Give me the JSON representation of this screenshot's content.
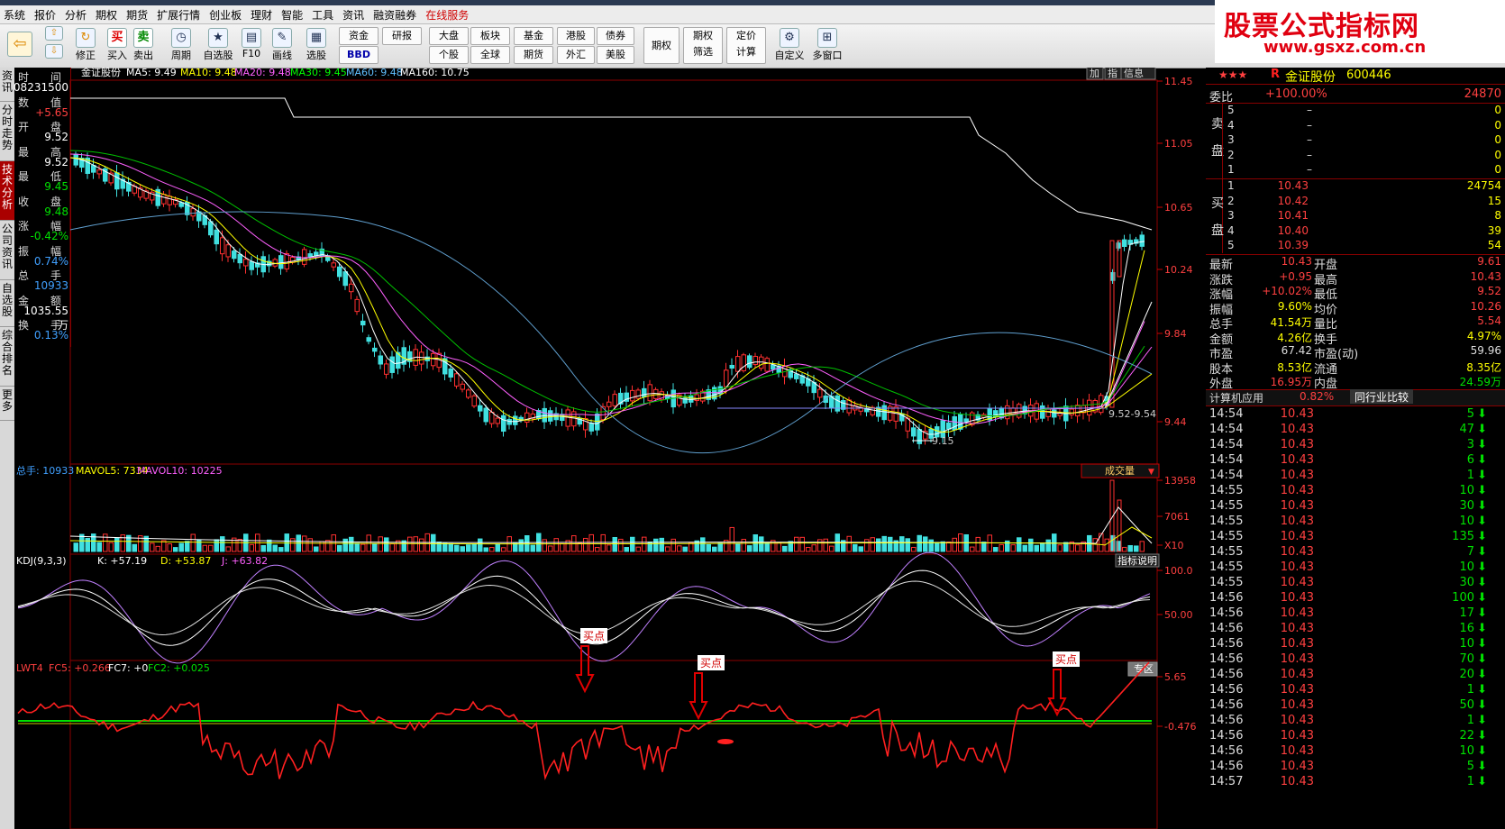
{
  "menu": {
    "items": [
      "系统",
      "报价",
      "分析",
      "期权",
      "期货",
      "扩展行情",
      "创业板",
      "理财",
      "智能",
      "工具",
      "资讯",
      "融资融券",
      "在线服务"
    ],
    "highlight": "在线服务"
  },
  "toolbar": {
    "buy": "买入",
    "sell": "卖出",
    "period": "周期",
    "fav": "自选股",
    "f10": "F10",
    "draw": "画线",
    "pick": "选股",
    "fix": "修正",
    "zj": "资金",
    "yb": "研报",
    "bbd": "BBD",
    "dp": "大盘",
    "bk": "板块",
    "jj": "基金",
    "gg": "港股",
    "zq": "债券",
    "gg2": "个股",
    "qq": "全球",
    "qh": "期货",
    "wh": "外汇",
    "mg": "美股",
    "qqn": "期权",
    "qqsx": "期权\n筛选",
    "djjs": "定价\n计算",
    "zdy": "自定义",
    "dck": "多窗口",
    "buy_glyph": "买",
    "sell_glyph": "卖"
  },
  "watermark": {
    "line1": "股票公式指标网",
    "line2": "www.gsxz.com.cn"
  },
  "vtabs": [
    {
      "label": "资讯",
      "on": false
    },
    {
      "label": "分时走势",
      "on": false
    },
    {
      "label": "技术分析",
      "on": true
    },
    {
      "label": "公司资讯",
      "on": false
    },
    {
      "label": "自选股",
      "on": false
    },
    {
      "label": "综合排名",
      "on": false
    },
    {
      "label": "更多",
      "on": false
    }
  ],
  "info": {
    "rows": [
      {
        "k": "时　　间",
        "v": "08231500",
        "c": "#ffffff"
      },
      {
        "k": "数　　值",
        "v": "+5.65",
        "c": "#ff4040"
      },
      {
        "k": "开　　盘",
        "v": "9.52",
        "c": "#ffffff"
      },
      {
        "k": "最　　高",
        "v": "9.52",
        "c": "#ffffff"
      },
      {
        "k": "最　　低",
        "v": "9.45",
        "c": "#00e000"
      },
      {
        "k": "收　　盘",
        "v": "9.48",
        "c": "#00e000"
      },
      {
        "k": "涨　　幅",
        "v": "-0.42%",
        "c": "#00e000"
      },
      {
        "k": "振　　幅",
        "v": "0.74%",
        "c": "#40a0ff"
      },
      {
        "k": "总　　手",
        "v": "10933",
        "c": "#40a0ff"
      },
      {
        "k": "金　　额",
        "v": "1035.55万",
        "c": "#ffffff"
      },
      {
        "k": "换　　手",
        "v": "0.13%",
        "c": "#40a0ff"
      }
    ]
  },
  "main": {
    "stock_name": "金证股份",
    "ma": [
      {
        "label": "MA5: 9.49",
        "color": "#ffffff"
      },
      {
        "label": "MA10: 9.48",
        "color": "#ffff00"
      },
      {
        "label": "MA20: 9.48",
        "color": "#ff60ff"
      },
      {
        "label": "MA30: 9.45",
        "color": "#00ff00"
      },
      {
        "label": "MA60: 9.48",
        "color": "#60c0ff"
      },
      {
        "label": "MA160: 10.75",
        "color": "#ffffff"
      }
    ],
    "buttons": [
      "加",
      "指",
      "信息"
    ],
    "y_ticks": [
      "11.45",
      "11.05",
      "10.65",
      "10.24",
      "9.84",
      "9.44"
    ],
    "annot_range": "9.52-9.54",
    "annot_low": "9.15"
  },
  "volume": {
    "header": "总手: 10933",
    "mavol5": "MAVOL5: 7334",
    "mavol10": "MAVOL10: 10225",
    "dropdown": "成交量",
    "y_ticks": [
      "13958",
      "7061",
      "X10"
    ]
  },
  "kdj": {
    "header": "KDJ(9,3,3)",
    "k": "K: +57.19",
    "d": "D: +53.87",
    "j": "J: +63.82",
    "button": "指标说明",
    "y_ticks": [
      "100.0",
      "50.00"
    ]
  },
  "lwt": {
    "header": "LWT4",
    "fc5": "FC5: +0.266",
    "fc7": "FC7: +0",
    "fc2": "FC2: +0.025",
    "button": "专区",
    "y_ticks": [
      "5.65",
      "-0.476"
    ],
    "buy_label": "买点"
  },
  "right": {
    "stars": "★★★",
    "r_icon": "R",
    "title": "金证股份",
    "code": "600446",
    "wb_label": "委比",
    "wb_val": "+100.00%",
    "wb_num": "24870",
    "sell_label": "卖盘",
    "buy_label": "买盘",
    "sells": [
      {
        "n": "5",
        "p": "–",
        "v": "0"
      },
      {
        "n": "4",
        "p": "–",
        "v": "0"
      },
      {
        "n": "3",
        "p": "–",
        "v": "0"
      },
      {
        "n": "2",
        "p": "–",
        "v": "0"
      },
      {
        "n": "1",
        "p": "–",
        "v": "0"
      }
    ],
    "buys": [
      {
        "n": "1",
        "p": "10.43",
        "v": "24754"
      },
      {
        "n": "2",
        "p": "10.42",
        "v": "15"
      },
      {
        "n": "3",
        "p": "10.41",
        "v": "8"
      },
      {
        "n": "4",
        "p": "10.40",
        "v": "39"
      },
      {
        "n": "5",
        "p": "10.39",
        "v": "54"
      }
    ],
    "stats": [
      {
        "k1": "最新",
        "v1": "10.43",
        "c1": "#ff4040",
        "k2": "开盘",
        "v2": "9.61",
        "c2": "#ff4040"
      },
      {
        "k1": "涨跌",
        "v1": "+0.95",
        "c1": "#ff4040",
        "k2": "最高",
        "v2": "10.43",
        "c2": "#ff4040"
      },
      {
        "k1": "涨幅",
        "v1": "+10.02%",
        "c1": "#ff4040",
        "k2": "最低",
        "v2": "9.52",
        "c2": "#ff4040"
      },
      {
        "k1": "振幅",
        "v1": "9.60%",
        "c1": "#ffff00",
        "k2": "均价",
        "v2": "10.26",
        "c2": "#ff4040"
      },
      {
        "k1": "总手",
        "v1": "41.54万",
        "c1": "#ffff00",
        "k2": "量比",
        "v2": "5.54",
        "c2": "#ff4040"
      },
      {
        "k1": "金额",
        "v1": "4.26亿",
        "c1": "#ffff00",
        "k2": "换手",
        "v2": "4.97%",
        "c2": "#ffff00"
      },
      {
        "k1": "市盈",
        "v1": "67.42",
        "c1": "#dddddd",
        "k2": "市盈(动)",
        "v2": "59.96",
        "c2": "#dddddd"
      },
      {
        "k1": "股本",
        "v1": "8.53亿",
        "c1": "#ffff00",
        "k2": "流通",
        "v2": "8.35亿",
        "c2": "#ffff00"
      },
      {
        "k1": "外盘",
        "v1": "16.95万",
        "c1": "#ff4040",
        "k2": "内盘",
        "v2": "24.59万",
        "c2": "#00e000"
      }
    ],
    "sector": "计算机应用",
    "sector_pct": "0.82%",
    "compare_btn": "同行业比较",
    "ticks": [
      {
        "t": "14:54",
        "p": "10.43",
        "v": "5",
        "dir": "down"
      },
      {
        "t": "14:54",
        "p": "10.43",
        "v": "47",
        "dir": "down"
      },
      {
        "t": "14:54",
        "p": "10.43",
        "v": "3",
        "dir": "down"
      },
      {
        "t": "14:54",
        "p": "10.43",
        "v": "6",
        "dir": "down"
      },
      {
        "t": "14:54",
        "p": "10.43",
        "v": "1",
        "dir": "down"
      },
      {
        "t": "14:55",
        "p": "10.43",
        "v": "10",
        "dir": "down"
      },
      {
        "t": "14:55",
        "p": "10.43",
        "v": "30",
        "dir": "down"
      },
      {
        "t": "14:55",
        "p": "10.43",
        "v": "10",
        "dir": "down"
      },
      {
        "t": "14:55",
        "p": "10.43",
        "v": "135",
        "dir": "down"
      },
      {
        "t": "14:55",
        "p": "10.43",
        "v": "7",
        "dir": "down"
      },
      {
        "t": "14:55",
        "p": "10.43",
        "v": "10",
        "dir": "down"
      },
      {
        "t": "14:55",
        "p": "10.43",
        "v": "30",
        "dir": "down"
      },
      {
        "t": "14:56",
        "p": "10.43",
        "v": "100",
        "dir": "down"
      },
      {
        "t": "14:56",
        "p": "10.43",
        "v": "17",
        "dir": "down"
      },
      {
        "t": "14:56",
        "p": "10.43",
        "v": "16",
        "dir": "down"
      },
      {
        "t": "14:56",
        "p": "10.43",
        "v": "10",
        "dir": "down"
      },
      {
        "t": "14:56",
        "p": "10.43",
        "v": "70",
        "dir": "down"
      },
      {
        "t": "14:56",
        "p": "10.43",
        "v": "20",
        "dir": "down"
      },
      {
        "t": "14:56",
        "p": "10.43",
        "v": "1",
        "dir": "down"
      },
      {
        "t": "14:56",
        "p": "10.43",
        "v": "50",
        "dir": "down"
      },
      {
        "t": "14:56",
        "p": "10.43",
        "v": "1",
        "dir": "down"
      },
      {
        "t": "14:56",
        "p": "10.43",
        "v": "22",
        "dir": "down"
      },
      {
        "t": "14:56",
        "p": "10.43",
        "v": "10",
        "dir": "down"
      },
      {
        "t": "14:56",
        "p": "10.43",
        "v": "5",
        "dir": "down"
      },
      {
        "t": "14:57",
        "p": "10.43",
        "v": "1",
        "dir": "down"
      }
    ]
  }
}
